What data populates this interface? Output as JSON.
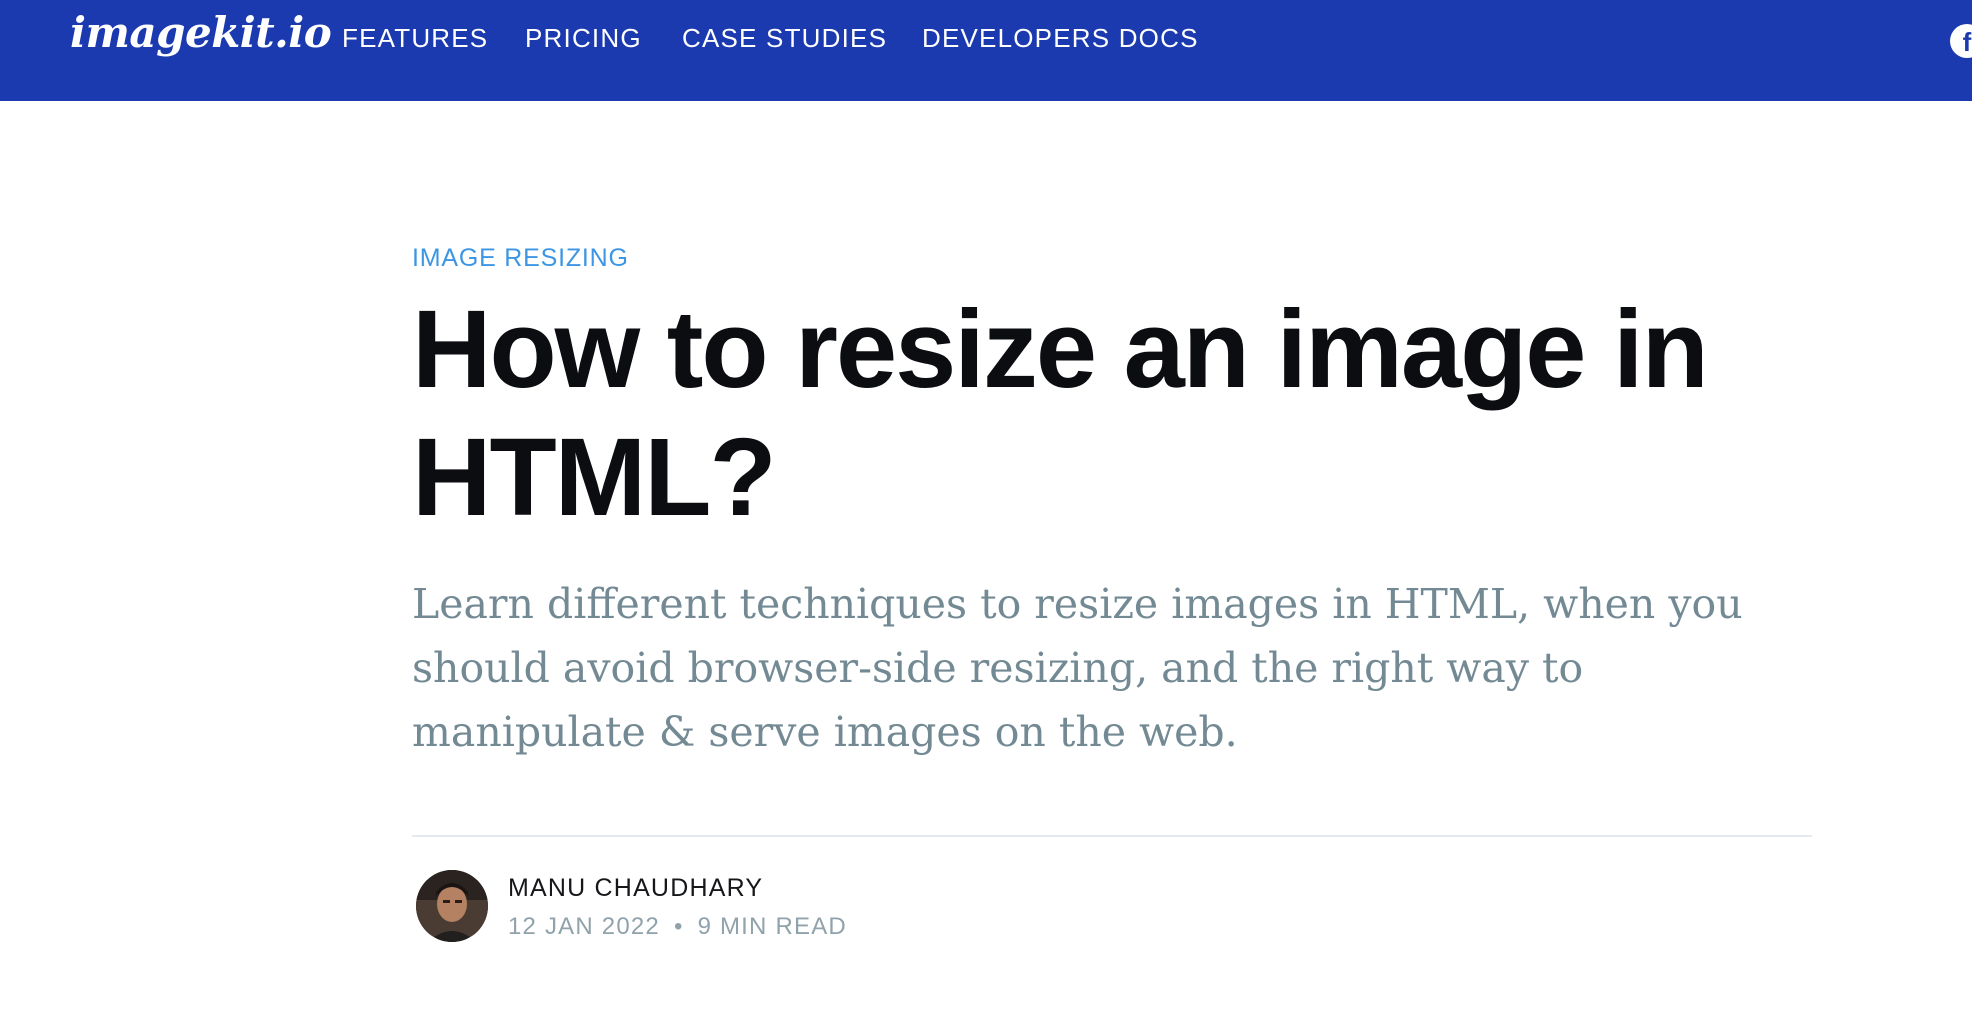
{
  "navbar": {
    "logo": "imagekit.io",
    "links": [
      {
        "label": "FEATURES"
      },
      {
        "label": "PRICING"
      },
      {
        "label": "CASE STUDIES"
      },
      {
        "label": "DEVELOPERS DOCS"
      }
    ],
    "social_icon": "facebook-icon",
    "social_glyph": "f",
    "background_color": "#1c3aaf"
  },
  "article": {
    "tag": "IMAGE RESIZING",
    "title": "How to resize an image in HTML?",
    "excerpt": "Learn different techniques to resize images in HTML, when you should avoid browser-side resizing, and the right way to manipulate & serve images on the web.",
    "author": {
      "name": "MANU CHAUDHARY",
      "avatar_icon": "author-avatar"
    },
    "date": "12 JAN 2022",
    "separator": "•",
    "reading_time": "9 MIN READ",
    "tag_color": "#3d96e4"
  }
}
